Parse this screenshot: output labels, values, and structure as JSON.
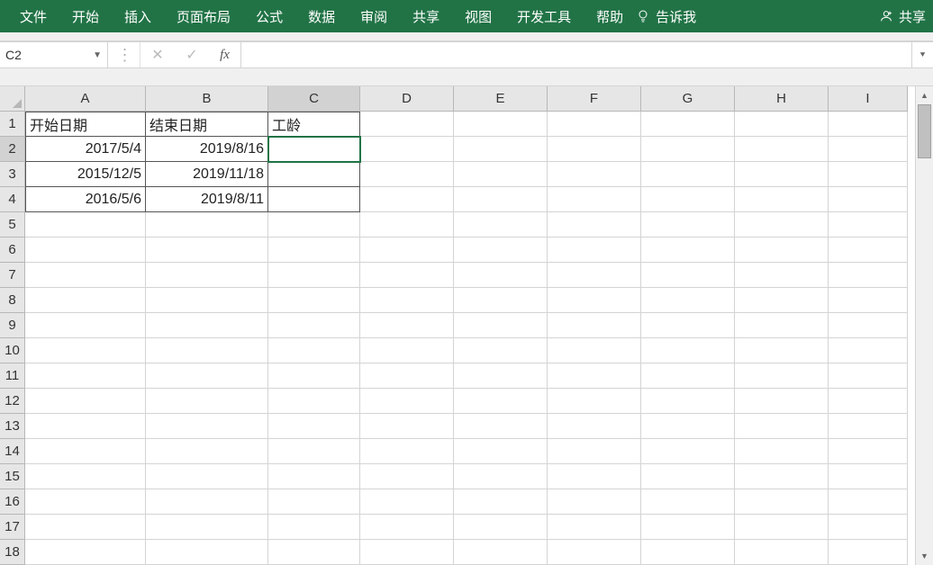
{
  "ribbon": {
    "tabs": [
      "文件",
      "开始",
      "插入",
      "页面布局",
      "公式",
      "数据",
      "审阅",
      "共享",
      "视图",
      "开发工具",
      "帮助"
    ],
    "tell_me": "告诉我",
    "share": "共享"
  },
  "formula_bar": {
    "name_box": "C2",
    "formula": ""
  },
  "columns": [
    "A",
    "B",
    "C",
    "D",
    "E",
    "F",
    "G",
    "H",
    "I"
  ],
  "rows": [
    1,
    2,
    3,
    4,
    5,
    6,
    7,
    8,
    9,
    10,
    11,
    12,
    13,
    14,
    15,
    16,
    17,
    18
  ],
  "active_cell": {
    "row": 2,
    "col": "C"
  },
  "data": {
    "A1": "开始日期",
    "B1": "结束日期",
    "C1": "工龄",
    "A2": "2017/5/4",
    "B2": "2019/8/16",
    "A3": "2015/12/5",
    "B3": "2019/11/18",
    "A4": "2016/5/6",
    "B4": "2019/8/11"
  },
  "colors": {
    "ribbon_bg": "#217346",
    "selection": "#217346"
  }
}
